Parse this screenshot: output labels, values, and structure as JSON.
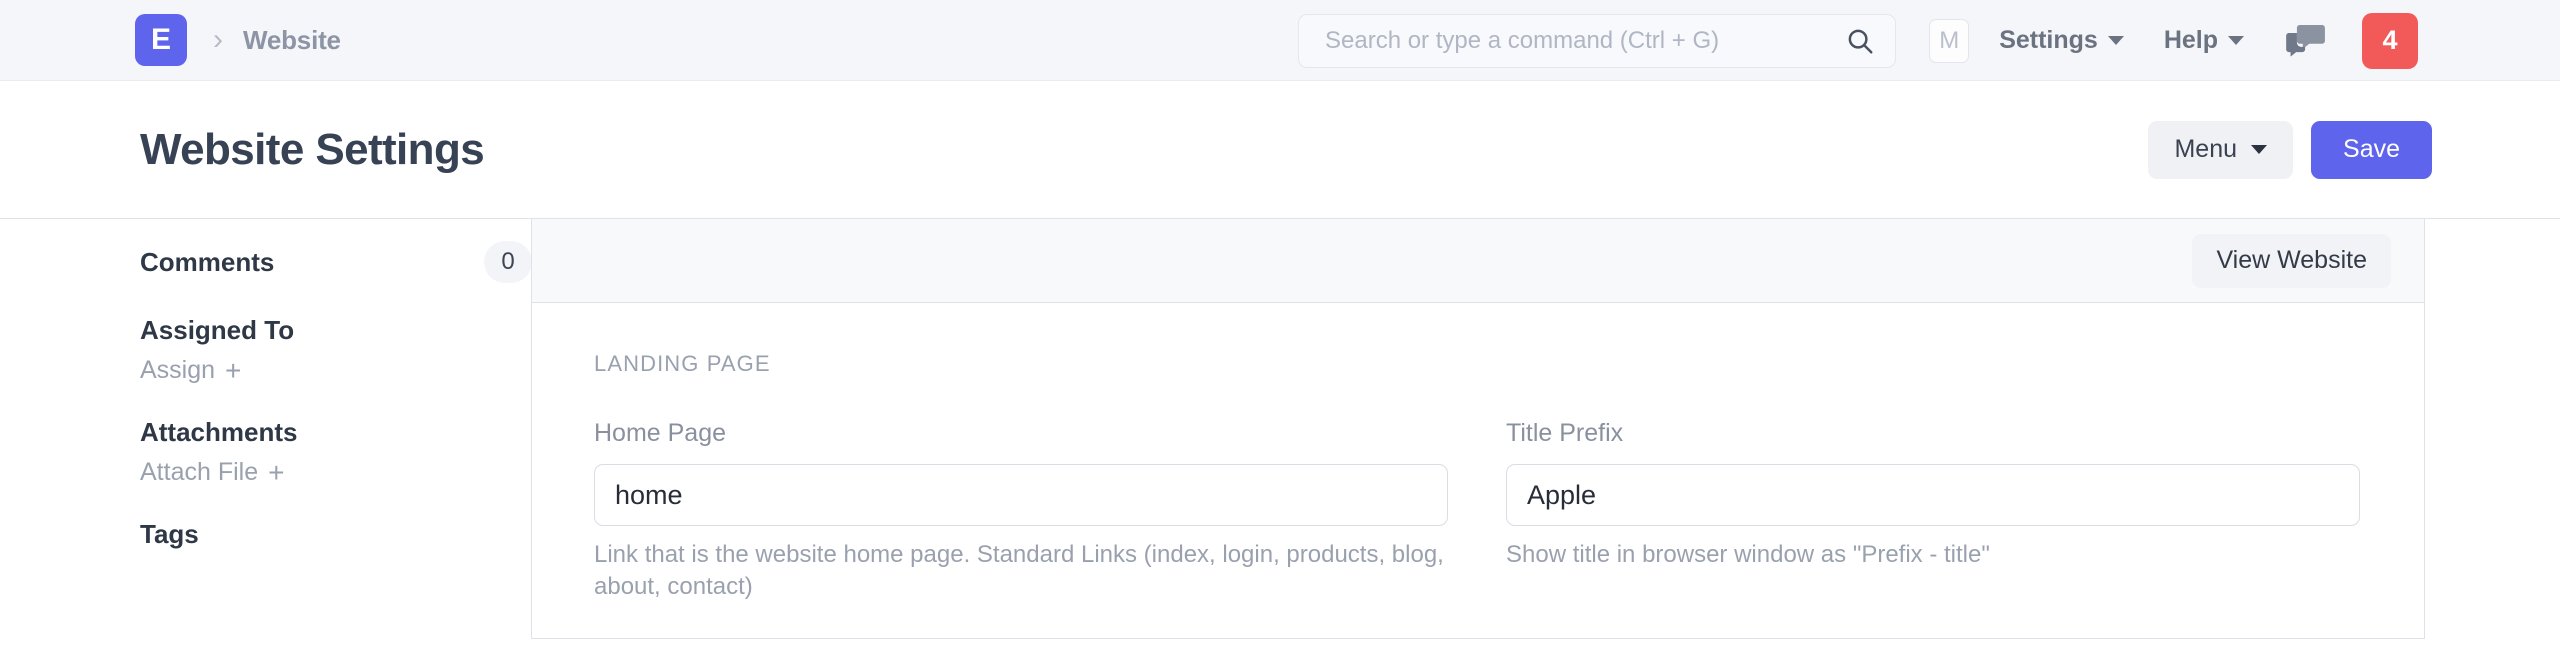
{
  "navbar": {
    "logo_letter": "E",
    "breadcrumb": "Website",
    "search": {
      "placeholder": "Search or type a command (Ctrl + G)",
      "value": "",
      "icon": "search-icon"
    },
    "avatar_letter": "M",
    "settings_label": "Settings",
    "help_label": "Help",
    "chat_icon": "chat-bubbles-icon",
    "notification_count": "4",
    "notification_color": "#f25a5a",
    "brand_color": "#5e64ec"
  },
  "titlebar": {
    "title": "Website Settings",
    "menu_label": "Menu",
    "save_label": "Save"
  },
  "sidebar": {
    "comments_label": "Comments",
    "comments_count": "0",
    "assigned_to_label": "Assigned To",
    "assign_action": "Assign",
    "attachments_label": "Attachments",
    "attach_action": "Attach File",
    "tags_label": "Tags"
  },
  "card": {
    "view_website_label": "View Website",
    "section_label": "LANDING PAGE",
    "fields": [
      {
        "label": "Home Page",
        "value": "home",
        "help": "Link that is the website home page. Standard Links (index, login, products, blog, about, contact)"
      },
      {
        "label": "Title Prefix",
        "value": "Apple",
        "help": "Show title in browser window as \"Prefix - title\""
      }
    ]
  }
}
